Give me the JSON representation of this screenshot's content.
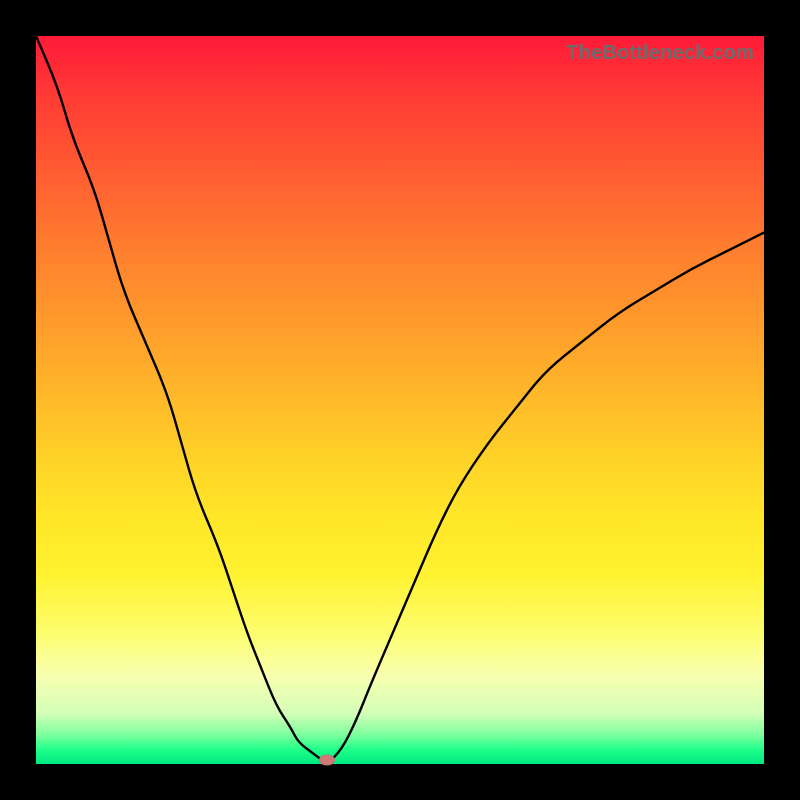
{
  "watermark": "TheBottleneck.com",
  "chart_data": {
    "type": "line",
    "title": "",
    "xlabel": "",
    "ylabel": "",
    "xlim": [
      0,
      1
    ],
    "ylim": [
      0,
      1
    ],
    "x": [
      0.0,
      0.03,
      0.05,
      0.08,
      0.1,
      0.12,
      0.15,
      0.18,
      0.2,
      0.22,
      0.25,
      0.27,
      0.29,
      0.31,
      0.33,
      0.35,
      0.36,
      0.38,
      0.4,
      0.42,
      0.44,
      0.46,
      0.49,
      0.52,
      0.55,
      0.58,
      0.62,
      0.66,
      0.7,
      0.75,
      0.8,
      0.85,
      0.9,
      0.95,
      1.0
    ],
    "values": [
      1.0,
      0.93,
      0.86,
      0.79,
      0.72,
      0.65,
      0.58,
      0.51,
      0.44,
      0.37,
      0.3,
      0.24,
      0.18,
      0.13,
      0.08,
      0.05,
      0.03,
      0.015,
      0.0,
      0.02,
      0.06,
      0.11,
      0.18,
      0.25,
      0.32,
      0.38,
      0.44,
      0.49,
      0.54,
      0.58,
      0.62,
      0.65,
      0.68,
      0.705,
      0.73
    ],
    "minimum_marker": {
      "x": 0.4,
      "y": 0.0
    },
    "grid": false,
    "legend": false,
    "background_gradient_top": "#ff1a38",
    "background_gradient_bottom": "#00e882",
    "curve_color": "#000000",
    "marker_color": "#cf7a78"
  }
}
